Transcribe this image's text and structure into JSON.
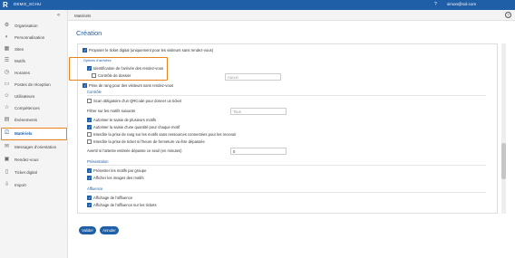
{
  "topbar": {
    "logo": "R",
    "org": "DEMO_SCHU",
    "help": "?",
    "user": "simon@sol.com"
  },
  "header": {
    "breadcrumb": "Matériels",
    "help": "?"
  },
  "sidebar": {
    "collapse": "«",
    "items": [
      {
        "label": "Organisation",
        "icon": "gear-icon"
      },
      {
        "label": "Personnalisation",
        "icon": "palette-icon"
      },
      {
        "label": "Sites",
        "icon": "building-icon"
      },
      {
        "label": "Motifs",
        "icon": "list-icon"
      },
      {
        "label": "Horaires",
        "icon": "clock-icon"
      },
      {
        "label": "Postes de réception",
        "icon": "desk-icon"
      },
      {
        "label": "Utilisateurs",
        "icon": "users-icon"
      },
      {
        "label": "Compétences",
        "icon": "star-icon"
      },
      {
        "label": "Événements",
        "icon": "calendar-icon"
      },
      {
        "label": "Matériels",
        "icon": "device-icon"
      },
      {
        "label": "Messages d'orientation",
        "icon": "message-icon"
      },
      {
        "label": "Rendez-vous",
        "icon": "appointment-icon"
      },
      {
        "label": "Ticket digital",
        "icon": "ticket-icon"
      },
      {
        "label": "Import",
        "icon": "import-icon"
      }
    ]
  },
  "title": "Création",
  "form": {
    "top_option": "Proposer le ticket digital (uniquement pour les visiteurs sans rendez-vous)",
    "section_arrival": "Options d'arrivées",
    "ident_arrival": "Identification de l'arrivée des rendez-vous",
    "control_folder": "Contrôle de dossier",
    "control_placeholder": "Aucun",
    "prise_rang": "Prise de rang pour des visiteurs sans rendez-vous",
    "section_control": "Contrôle",
    "scan_qr": "Scan obligatoire d'un QRCode pour donner un ticket",
    "filter_label": "Filtrer sur les motifs suivants",
    "filter_value": "Tous",
    "multi_motifs": "Autoriser le saisie de plusieurs motifs",
    "qty_motif": "Autoriser la saisie d'une quantité pour chaque motif",
    "forbid_saturated": "Interdire la prise de rang sur les motifs sans ressources connectées pour les recevoir",
    "forbid_after_hours": "Interdire la prise de ticket si l'heure de fermeture va être dépassée",
    "warn_wait": "Avertir si l'attente estimée dépasse ce seuil (en minutes)",
    "warn_value": "0",
    "section_presentation": "Présentation",
    "present_group": "Présenter les motifs par groupe",
    "show_images": "Afficher les images des motifs",
    "section_affluence": "Affluence",
    "show_affluence": "Affichage de l'affluence",
    "show_affluence_tickets": "Affichage de l'affluence sur les tickets"
  },
  "buttons": {
    "validate": "Valider",
    "cancel": "Annuler"
  },
  "colors": {
    "brand": "#1f5fa8",
    "highlight": "#e8821a"
  }
}
